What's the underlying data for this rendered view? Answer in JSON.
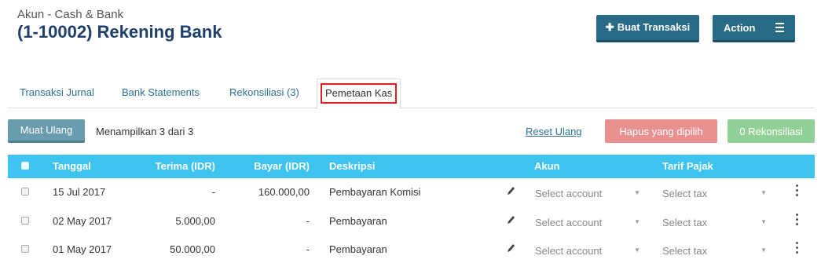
{
  "header": {
    "subtitle": "Akun - Cash & Bank",
    "title": "(1-10002) Rekening Bank",
    "create_button": "Buat Transaksi",
    "action_button": "Action"
  },
  "tabs": [
    {
      "label": "Transaksi Jurnal"
    },
    {
      "label": "Bank Statements"
    },
    {
      "label": "Rekonsiliasi (3)"
    },
    {
      "label": "Pemetaan Kas"
    }
  ],
  "toolbar": {
    "reload_label": "Muat Ulang",
    "showing_text": "Menampilkan 3 dari 3",
    "reset_label": "Reset Ulang",
    "delete_label": "Hapus yang dipilih",
    "reconcile_label": "0 Rekonsiliasi"
  },
  "table": {
    "columns": [
      "Tanggal",
      "Terima (IDR)",
      "Bayar (IDR)",
      "Deskripsi",
      "Akun",
      "Tarif Pajak"
    ],
    "rows": [
      {
        "date": "15 Jul 2017",
        "receive": "-",
        "pay": "160.000,00",
        "description": "Pembayaran Komisi",
        "account": "Select account",
        "tax": "Select tax"
      },
      {
        "date": "02 May 2017",
        "receive": "5.000,00",
        "pay": "-",
        "description": "Pembayaran",
        "account": "Select account",
        "tax": "Select tax"
      },
      {
        "date": "01 May 2017",
        "receive": "50.000,00",
        "pay": "-",
        "description": "Pembayaran",
        "account": "Select account",
        "tax": "Select tax"
      }
    ]
  },
  "colors": {
    "primary": "#276b86",
    "table_header": "#3fc3ef",
    "delete": "#e88f8f",
    "reconcile": "#93d098",
    "highlight": "#e21d1d"
  },
  "icons": [
    "plus-icon",
    "hamburger-menu-icon",
    "pencil-icon",
    "kebab-menu-icon",
    "caret-down-icon"
  ]
}
